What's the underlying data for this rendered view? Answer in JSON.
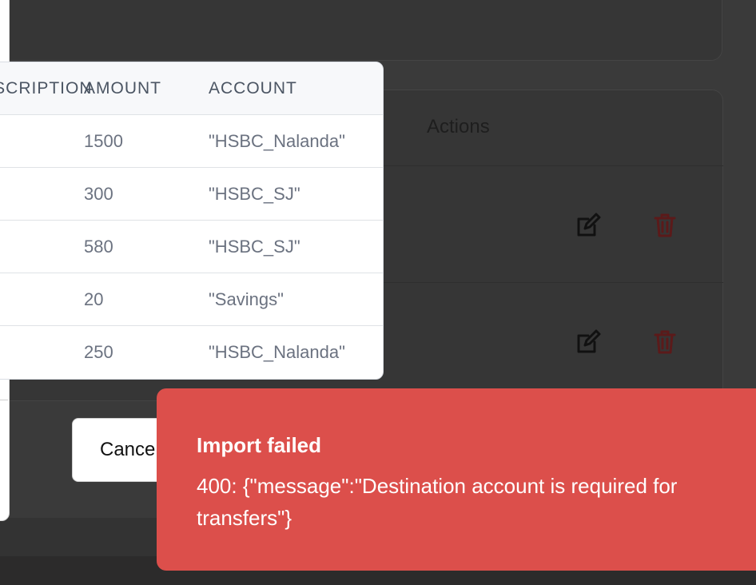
{
  "background": {
    "actions_header": "Actions",
    "row_icons": [
      {
        "edit": "edit-icon",
        "delete": "trash-icon"
      },
      {
        "edit": "edit-icon",
        "delete": "trash-icon"
      }
    ]
  },
  "modal": {
    "cancel_label": "Cancel",
    "preview_table": {
      "headers": {
        "description": "DESCRIPTION",
        "amount": "AMOUNT",
        "account": "ACCOUNT"
      },
      "rows": [
        {
          "amount": "1500",
          "account": "\"HSBC_Nalanda\""
        },
        {
          "amount": "300",
          "account": "\"HSBC_SJ\""
        },
        {
          "amount": "580",
          "account": "\"HSBC_SJ\""
        },
        {
          "amount": "20",
          "account": "\"Savings\""
        },
        {
          "amount": "250",
          "account": "\"HSBC_Nalanda\""
        }
      ]
    }
  },
  "toast": {
    "title": "Import failed",
    "message": "400: {\"message\":\"Destination account is required for transfers\"}",
    "color": "#dc4f4b"
  }
}
